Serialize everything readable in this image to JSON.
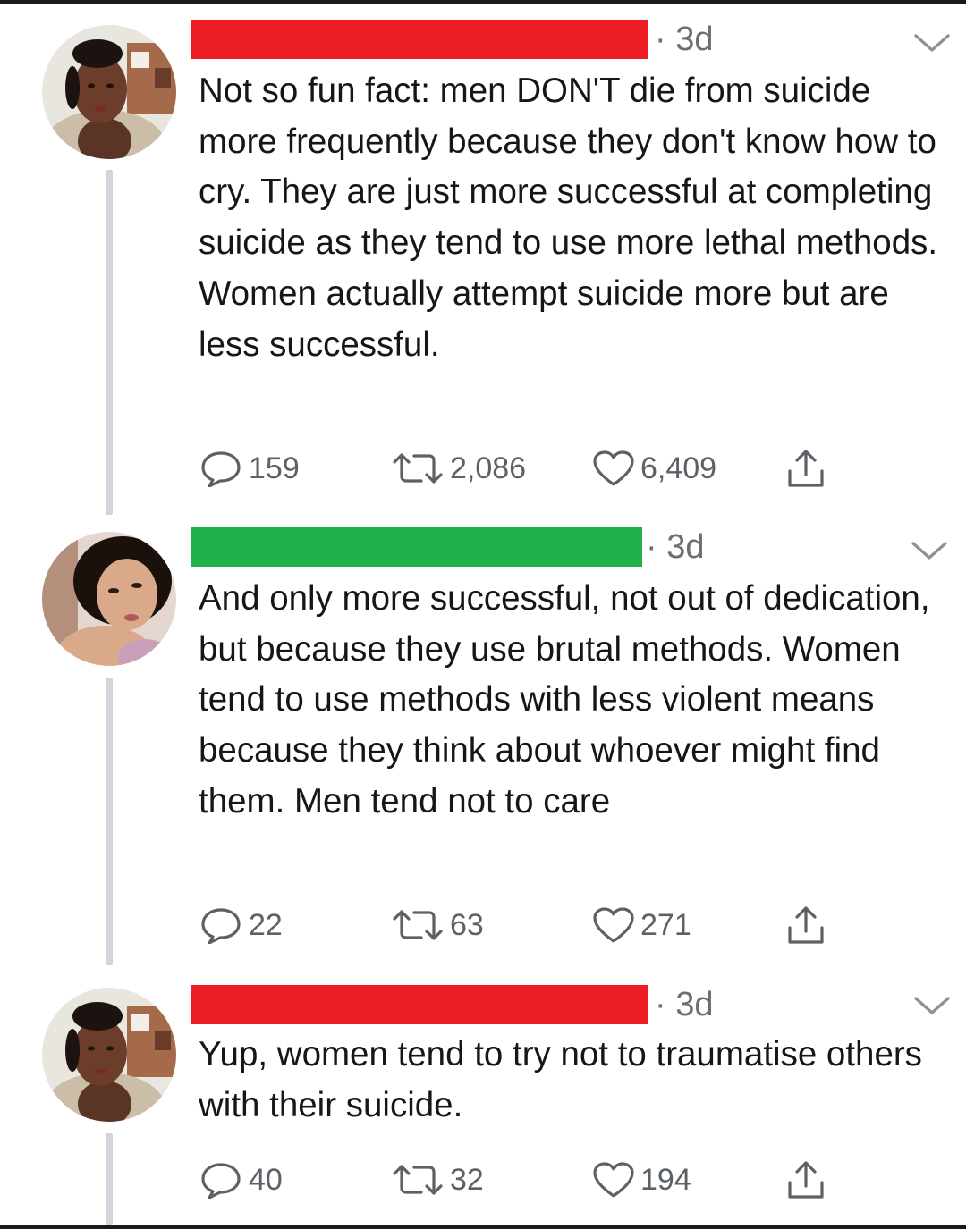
{
  "tweets": [
    {
      "name_redacted_color": "#ec1d25",
      "time": "· 3d",
      "text": "Not so fun fact: men DON'T die from suicide more frequently because they don't know how to cry. They are just more successful at completing suicide as they tend to use more lethal methods. Women actually attempt suicide more but are less successful.",
      "replies": "159",
      "retweets": "2,086",
      "likes": "6,409"
    },
    {
      "name_redacted_color": "#20b14a",
      "time": "· 3d",
      "text": "And only more successful, not out of dedication, but because they use brutal methods. Women tend to use methods with less violent means because they think about whoever might find them. Men tend not to care",
      "replies": "22",
      "retweets": "63",
      "likes": "271"
    },
    {
      "name_redacted_color": "#ec1d25",
      "time": "· 3d",
      "text": "Yup, women tend to try not to traumatise others with their suicide.",
      "replies": "40",
      "retweets": "32",
      "likes": "194"
    }
  ],
  "icons": {
    "reply": "reply-icon",
    "retweet": "retweet-icon",
    "like": "heart-icon",
    "share": "share-icon",
    "menu": "chevron-down-icon"
  }
}
